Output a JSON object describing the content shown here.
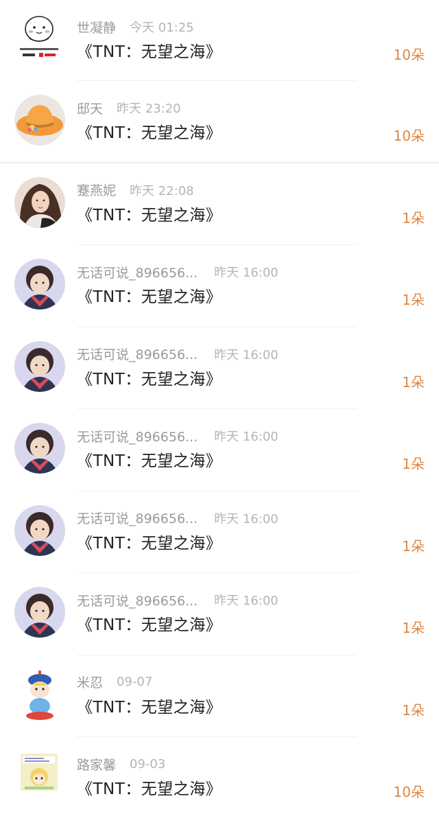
{
  "accent_color": "#e0853f",
  "gifts": [
    {
      "name": "世凝静",
      "time": "今天 01:25",
      "title": "《TNT：无望之海》",
      "amount": "10朵",
      "avatar_icon": "bun-sticker-avatar"
    },
    {
      "name": "邸天",
      "time": "昨天 23:20",
      "title": "《TNT：无望之海》",
      "amount": "10朵",
      "avatar_icon": "orange-hat-avatar"
    },
    {
      "name": "蹇燕妮",
      "time": "昨天 22:08",
      "title": "《TNT：无望之海》",
      "amount": "1朵",
      "avatar_icon": "woman-selfie-avatar"
    },
    {
      "name": "无话可说_896656...",
      "time": "昨天 16:00",
      "title": "《TNT：无望之海》",
      "amount": "1朵",
      "avatar_icon": "child-photo-avatar"
    },
    {
      "name": "无话可说_896656...",
      "time": "昨天 16:00",
      "title": "《TNT：无望之海》",
      "amount": "1朵",
      "avatar_icon": "child-photo-avatar"
    },
    {
      "name": "无话可说_896656...",
      "time": "昨天 16:00",
      "title": "《TNT：无望之海》",
      "amount": "1朵",
      "avatar_icon": "child-photo-avatar"
    },
    {
      "name": "无话可说_896656...",
      "time": "昨天 16:00",
      "title": "《TNT：无望之海》",
      "amount": "1朵",
      "avatar_icon": "child-photo-avatar"
    },
    {
      "name": "无话可说_896656...",
      "time": "昨天 16:00",
      "title": "《TNT：无望之海》",
      "amount": "1朵",
      "avatar_icon": "child-photo-avatar"
    },
    {
      "name": "米忍",
      "time": "09-07",
      "title": "《TNT：无望之海》",
      "amount": "1朵",
      "avatar_icon": "cartoon-official-avatar"
    },
    {
      "name": "路家馨",
      "time": "09-03",
      "title": "《TNT：无望之海》",
      "amount": "10朵",
      "avatar_icon": "cartoon-meme-avatar"
    }
  ]
}
